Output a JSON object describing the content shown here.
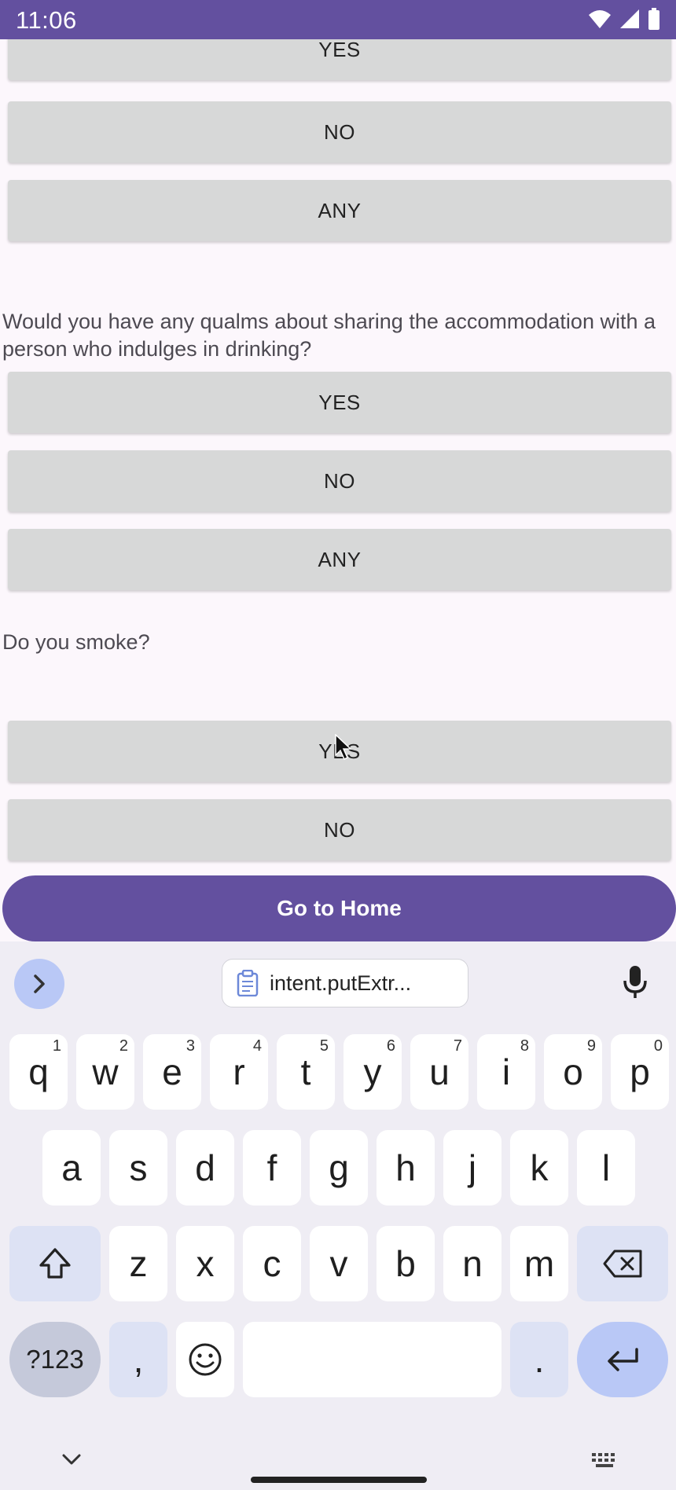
{
  "status_bar": {
    "time": "11:06"
  },
  "form": {
    "q_prev": {
      "yes": "YES",
      "no": "NO",
      "any": "ANY"
    },
    "q_drinking": {
      "text": "Would you have any qualms about sharing the accommodation with a person who indulges in drinking?",
      "yes": "YES",
      "no": "NO",
      "any": "ANY"
    },
    "q_smoke": {
      "text": "Do you smoke?",
      "yes": "YES",
      "no": "NO"
    },
    "home_button": "Go to Home"
  },
  "keyboard": {
    "clipboard_suggestion": "intent.putExtr...",
    "row1": [
      {
        "key": "q",
        "hint": "1"
      },
      {
        "key": "w",
        "hint": "2"
      },
      {
        "key": "e",
        "hint": "3"
      },
      {
        "key": "r",
        "hint": "4"
      },
      {
        "key": "t",
        "hint": "5"
      },
      {
        "key": "y",
        "hint": "6"
      },
      {
        "key": "u",
        "hint": "7"
      },
      {
        "key": "i",
        "hint": "8"
      },
      {
        "key": "o",
        "hint": "9"
      },
      {
        "key": "p",
        "hint": "0"
      }
    ],
    "row2": [
      "a",
      "s",
      "d",
      "f",
      "g",
      "h",
      "j",
      "k",
      "l"
    ],
    "row3": [
      "z",
      "x",
      "c",
      "v",
      "b",
      "n",
      "m"
    ],
    "symbols_key": "?123",
    "comma_key": ",",
    "period_key": "."
  }
}
